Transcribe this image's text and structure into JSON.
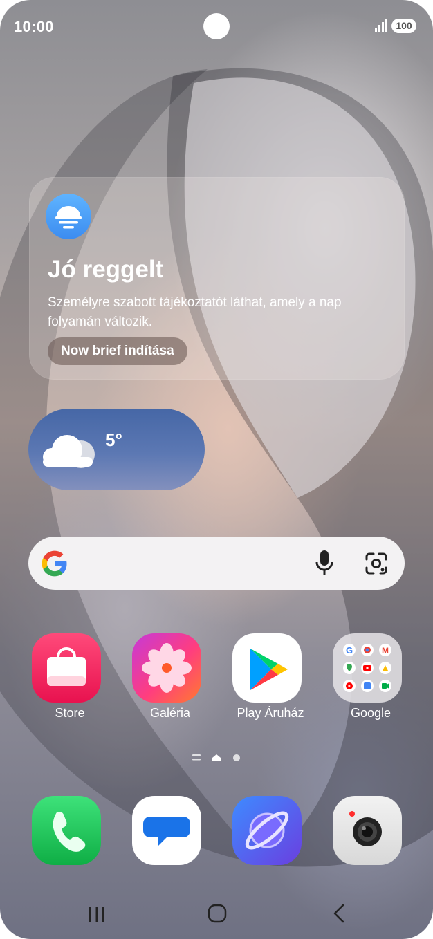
{
  "status_bar": {
    "time": "10:00",
    "battery": "100"
  },
  "brief_card": {
    "title": "Jó reggelt",
    "text": "Személyre szabott tájékoztatót láthat, amely a nap folyamán változik.",
    "button_label": "Now brief indítása"
  },
  "weather": {
    "temperature": "5°"
  },
  "apps": [
    {
      "label": "Store"
    },
    {
      "label": "Galéria"
    },
    {
      "label": "Play Áruház"
    },
    {
      "label": "Google"
    }
  ],
  "colors": {
    "brief_icon": "#3c8cf0",
    "weather_top": "#4667a6",
    "phone": "#1fbf4f",
    "internet": "#5a4fe0"
  },
  "icons": [
    "brief-icon",
    "cloud-icon",
    "google-logo-icon",
    "mic-icon",
    "lens-icon",
    "store-icon",
    "gallery-icon",
    "play-store-icon",
    "google-folder-icon",
    "phone-icon",
    "messages-icon",
    "internet-icon",
    "camera-icon",
    "recents-icon",
    "home-icon",
    "back-icon"
  ]
}
